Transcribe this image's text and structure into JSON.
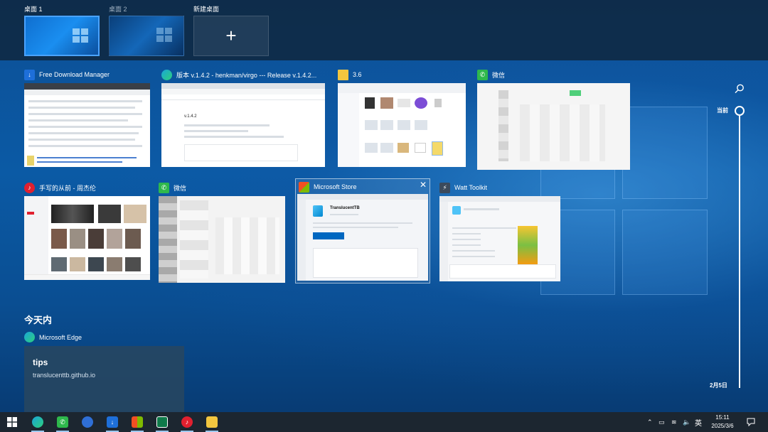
{
  "desktops": [
    {
      "label": "桌面 1",
      "active": true
    },
    {
      "label": "桌面 2",
      "active": false
    },
    {
      "label": "新建桌面",
      "icon": "plus-icon"
    }
  ],
  "windows": [
    {
      "title": "Free Download Manager",
      "icon": "fdm-icon"
    },
    {
      "title": "版本 v.1.4.2 - henkman/virgo --- Release v.1.4.2...",
      "icon": "edge-icon"
    },
    {
      "title": "3.6",
      "icon": "folder-icon"
    },
    {
      "title": "微信",
      "icon": "wechat-icon"
    },
    {
      "title": "手写的从前 - 周杰伦",
      "icon": "netease-music-icon"
    },
    {
      "title": "微信",
      "icon": "wechat-icon"
    },
    {
      "title": "Microsoft Store",
      "icon": "store-icon",
      "close": "✕"
    },
    {
      "title": "Watt Toolkit",
      "icon": "watt-toolkit-icon"
    }
  ],
  "thumb_text": {
    "store_app_name": "TranslucentTB",
    "virgo_version": "v.1.4.2"
  },
  "timeline": {
    "current_label": "当前",
    "date_label": "2月5日"
  },
  "today": {
    "heading": "今天内",
    "app": "Microsoft Edge",
    "card_title": "tips",
    "card_url": "translucenttb.github.io"
  },
  "taskbar": {
    "ime": "英",
    "time": "15:11",
    "date": "2025/3/6"
  },
  "colors": {
    "accent": "#4aa3ff",
    "taskbar": "#1c2630",
    "desktop": "#0b5aa5"
  }
}
